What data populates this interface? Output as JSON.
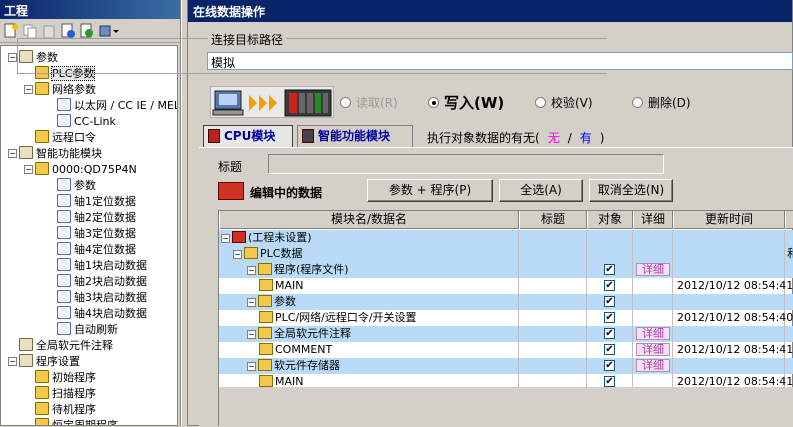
{
  "project": {
    "title": "工程",
    "tree": [
      {
        "label": "参数",
        "level": 0,
        "expander": "−"
      },
      {
        "label": "PLC参数",
        "level": 1,
        "selected": true
      },
      {
        "label": "网络参数",
        "level": 1,
        "expander": "−"
      },
      {
        "label": "以太网 / CC IE / MEL",
        "level": 2
      },
      {
        "label": "CC-Link",
        "level": 2
      },
      {
        "label": "远程口令",
        "level": 1
      },
      {
        "label": "智能功能模块",
        "level": 0,
        "expander": "−"
      },
      {
        "label": "0000:QD75P4N",
        "level": 1,
        "expander": "−"
      },
      {
        "label": "参数",
        "level": 2
      },
      {
        "label": "轴1定位数据",
        "level": 2
      },
      {
        "label": "轴2定位数据",
        "level": 2
      },
      {
        "label": "轴3定位数据",
        "level": 2
      },
      {
        "label": "轴4定位数据",
        "level": 2
      },
      {
        "label": "轴1块启动数据",
        "level": 2
      },
      {
        "label": "轴2块启动数据",
        "level": 2
      },
      {
        "label": "轴3块启动数据",
        "level": 2
      },
      {
        "label": "轴4块启动数据",
        "level": 2
      },
      {
        "label": "自动刷新",
        "level": 2
      },
      {
        "label": "全局软元件注释",
        "level": 0
      },
      {
        "label": "程序设置",
        "level": 0,
        "expander": "−"
      },
      {
        "label": "初始程序",
        "level": 1
      },
      {
        "label": "扫描程序",
        "level": 1
      },
      {
        "label": "待机程序",
        "level": 1
      },
      {
        "label": "恒定周期程序",
        "level": 1
      }
    ]
  },
  "dialog": {
    "title": "在线数据操作",
    "connection_label": "连接目标路径",
    "connection_value": "模拟",
    "operations": [
      {
        "label": "读取(R)",
        "selected": false,
        "disabled": true
      },
      {
        "label": "写入(W)",
        "selected": true,
        "disabled": false
      },
      {
        "label": "校验(V)",
        "selected": false,
        "disabled": false
      },
      {
        "label": "删除(D)",
        "selected": false,
        "disabled": false
      }
    ],
    "tabs": [
      {
        "label": "CPU模块",
        "active": true
      },
      {
        "label": "智能功能模块",
        "active": false
      }
    ],
    "target_info": {
      "prefix": "执行对象数据的有无(",
      "no": "无",
      "sep": "/",
      "yes": "有",
      "suffix": ")"
    },
    "title_label": "标题",
    "editing_label": "编辑中的数据",
    "buttons": {
      "param_program": "参数 + 程序(P)",
      "select_all": "全选(A)",
      "deselect_all": "取消全选(N)"
    },
    "columns": [
      "模块名/数据名",
      "标题",
      "对象",
      "详细",
      "更新时间"
    ],
    "rows": [
      {
        "level": 0,
        "expander": "−",
        "icon": "project-icon",
        "name": "(工程未设置)",
        "checked": false,
        "detail": "",
        "time": "",
        "hl": true
      },
      {
        "level": 1,
        "expander": "−",
        "icon": "folder-icon",
        "name": "PLC数据",
        "checked": false,
        "detail": "",
        "time": "",
        "hl": true,
        "trail": "和"
      },
      {
        "level": 2,
        "expander": "−",
        "icon": "program-icon",
        "name": "程序(程序文件)",
        "checked": true,
        "detail": "详细",
        "time": "",
        "hl": true
      },
      {
        "level": 3,
        "expander": "",
        "icon": "file-icon",
        "name": "MAIN",
        "checked": true,
        "detail": "",
        "time": "2012/10/12 08:54:41",
        "hl": false
      },
      {
        "level": 2,
        "expander": "−",
        "icon": "param-icon",
        "name": "参数",
        "checked": true,
        "detail": "",
        "time": "",
        "hl": true
      },
      {
        "level": 3,
        "expander": "",
        "icon": "param-file-icon",
        "name": "PLC/网络/远程口令/开关设置",
        "checked": true,
        "detail": "",
        "time": "2012/10/12 08:54:40",
        "hl": false
      },
      {
        "level": 2,
        "expander": "−",
        "icon": "comment-icon",
        "name": "全局软元件注释",
        "checked": true,
        "detail": "详细",
        "time": "",
        "hl": true
      },
      {
        "level": 3,
        "expander": "",
        "icon": "file-icon",
        "name": "COMMENT",
        "checked": true,
        "detail": "详细",
        "time": "2012/10/12 08:54:41",
        "hl": false
      },
      {
        "level": 2,
        "expander": "−",
        "icon": "memory-icon",
        "name": "软元件存储器",
        "checked": true,
        "detail": "详细",
        "time": "",
        "hl": true
      },
      {
        "level": 3,
        "expander": "",
        "icon": "file-icon",
        "name": "MAIN",
        "checked": true,
        "detail": "",
        "time": "2012/10/12 08:54:41",
        "hl": false
      }
    ]
  }
}
